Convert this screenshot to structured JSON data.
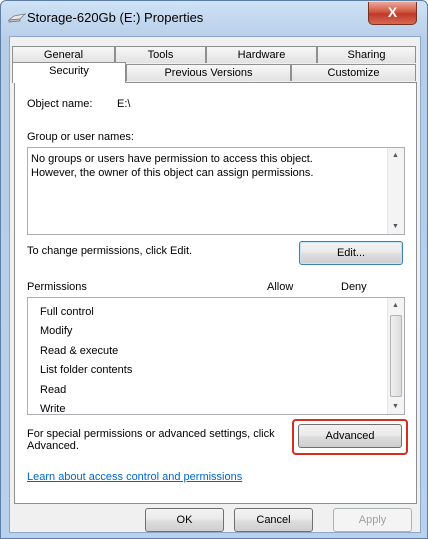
{
  "window": {
    "title": "Storage-620Gb (E:) Properties",
    "close_glyph": "X"
  },
  "tabs_row1": [
    "General",
    "Tools",
    "Hardware",
    "Sharing"
  ],
  "tabs_row2": [
    "Security",
    "Previous Versions",
    "Customize"
  ],
  "security": {
    "object_name_label": "Object name:",
    "object_name_value": "E:\\",
    "group_label": "Group or user names:",
    "group_message": "No groups or users have permission to access this object. However, the owner of this object can assign permissions.",
    "change_text": "To change permissions, click Edit.",
    "edit_button": "Edit...",
    "permissions_label": "Permissions",
    "allow_label": "Allow",
    "deny_label": "Deny",
    "permissions": [
      "Full control",
      "Modify",
      "Read & execute",
      "List folder contents",
      "Read",
      "Write"
    ],
    "special_text": "For special permissions or advanced settings, click Advanced.",
    "advanced_button": "Advanced",
    "learn_link": "Learn about access control and permissions"
  },
  "footer": {
    "ok": "OK",
    "cancel": "Cancel",
    "apply": "Apply"
  },
  "colors": {
    "highlight_ring": "#d42e21",
    "link": "#0066cc"
  }
}
